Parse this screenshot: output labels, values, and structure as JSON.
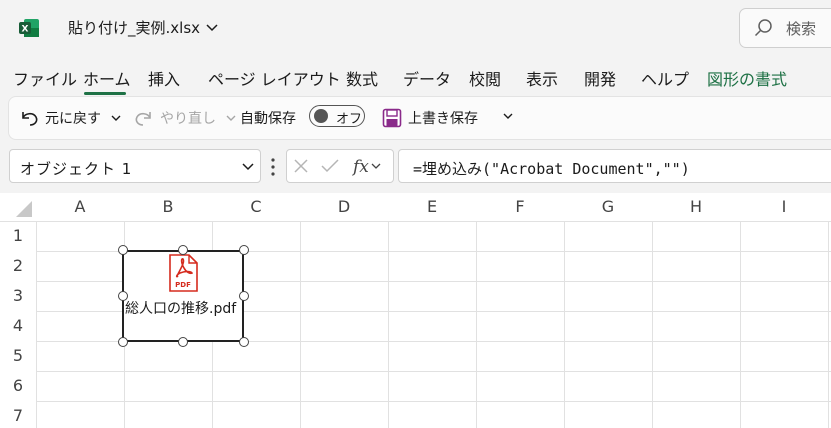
{
  "app": {
    "title": "貼り付け_実例.xlsx",
    "search_label": "検索"
  },
  "tabs": [
    {
      "label": "ファイル"
    },
    {
      "label": "ホーム"
    },
    {
      "label": "挿入"
    },
    {
      "label": "ページ レイアウト"
    },
    {
      "label": "数式"
    },
    {
      "label": "データ"
    },
    {
      "label": "校閲"
    },
    {
      "label": "表示"
    },
    {
      "label": "開発"
    },
    {
      "label": "ヘルプ"
    },
    {
      "label": "図形の書式"
    }
  ],
  "active_tab": "ホーム",
  "ribbon": {
    "undo_label": "元に戻す",
    "redo_label": "やり直し",
    "autosave_label": "自動保存",
    "autosave_state": "オフ",
    "save_label": "上書き保存"
  },
  "formula_bar": {
    "name_box": "オブジェクト 1",
    "formula": "=埋め込み(\"Acrobat Document\",\"\")"
  },
  "grid": {
    "columns": [
      "A",
      "B",
      "C",
      "D",
      "E",
      "F",
      "G",
      "H",
      "I"
    ],
    "rows": [
      "1",
      "2",
      "3",
      "4",
      "5",
      "6",
      "7"
    ]
  },
  "embedded_object": {
    "filename": "総人口の推移.pdf",
    "icon_text": "PDF"
  },
  "colors": {
    "accent": "#1e7145",
    "pdf_red": "#d52b1e"
  }
}
